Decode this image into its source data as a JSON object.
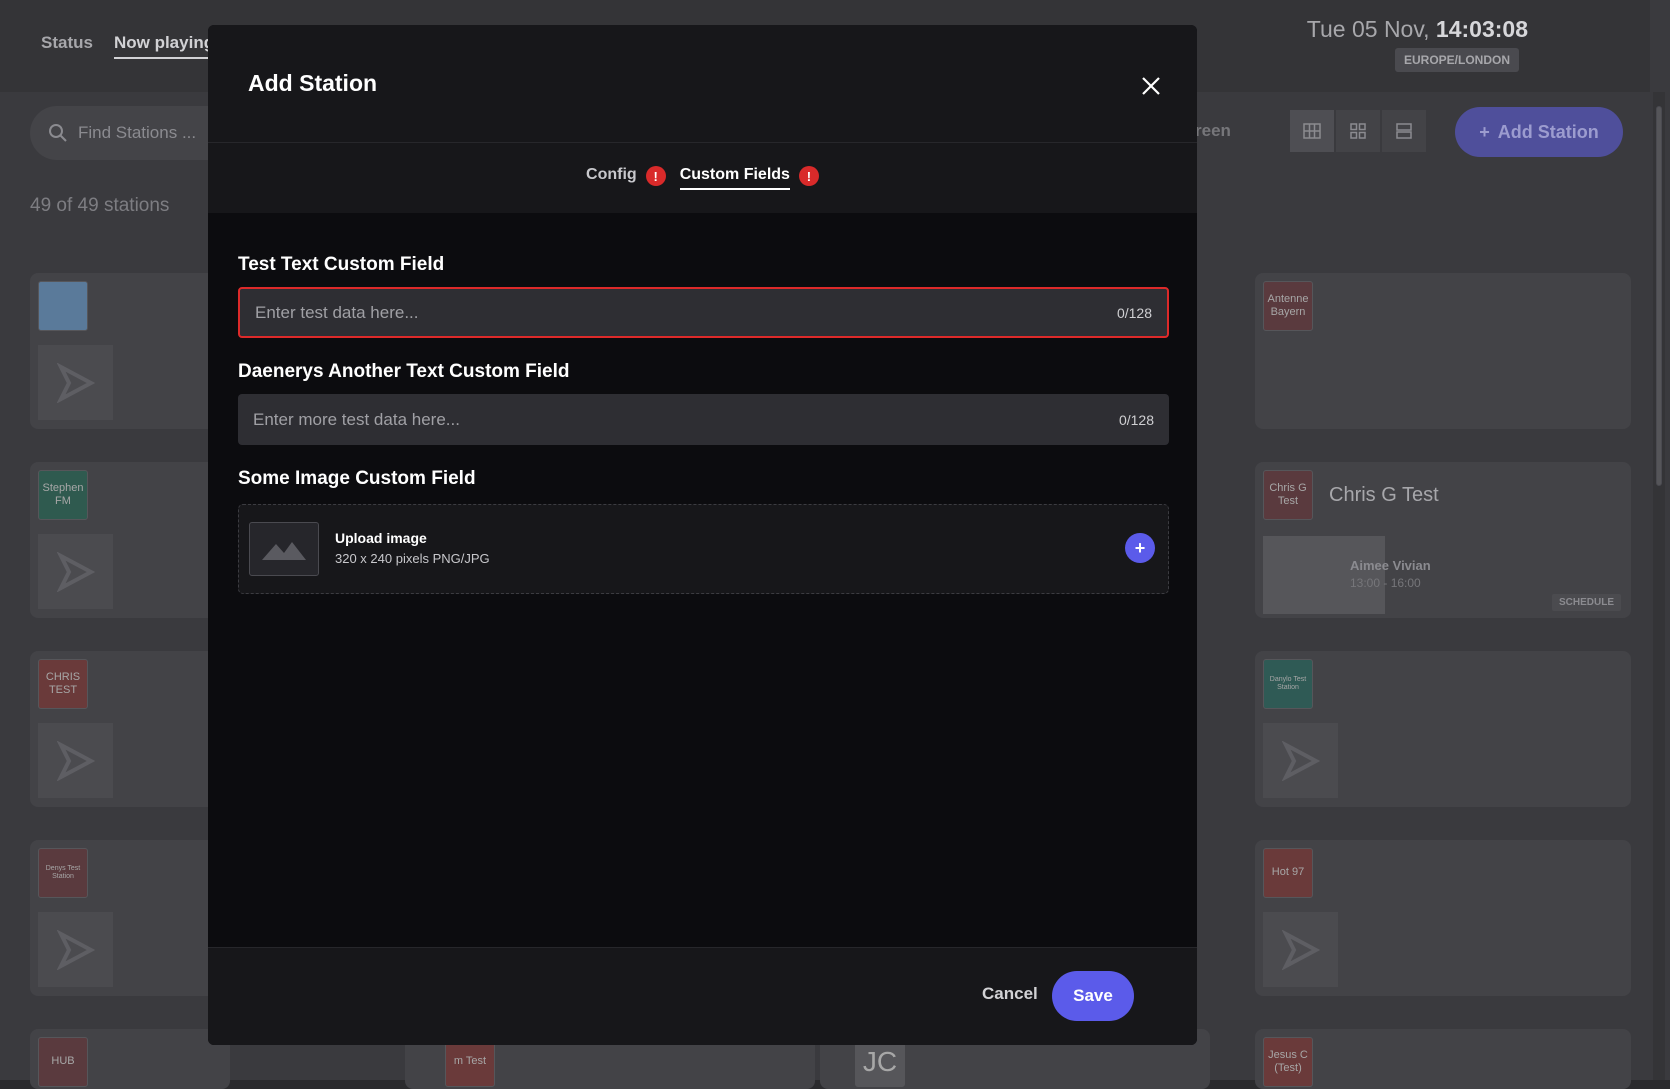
{
  "nav": {
    "status": "Status",
    "now_playing": "Now playing"
  },
  "clock": {
    "date": "Tue 05 Nov,",
    "time": "14:03:08",
    "timezone": "EUROPE/LONDON"
  },
  "search": {
    "placeholder": "Find Stations ..."
  },
  "station_count": "49 of 49 stations",
  "toolbar": {
    "screen_label": "reen",
    "add_station": "Add Station"
  },
  "stations_left": [
    {
      "logo": ""
    },
    {
      "logo": "Stephen FM"
    },
    {
      "logo": "CHRIS TEST"
    },
    {
      "logo": "Denys Test Station"
    },
    {
      "logo": "HUB"
    }
  ],
  "stations_right": [
    {
      "logo": "Antenne Bayern",
      "name": ""
    },
    {
      "logo": "Chris G Test",
      "name": "Chris G Test",
      "host": "Aimee Vivian",
      "time": "13:00 - 16:00",
      "schedule": "SCHEDULE"
    },
    {
      "logo": "Danylo Test Station",
      "name": ""
    },
    {
      "logo": "Hot 97",
      "name": ""
    },
    {
      "logo": "Jesus C (Test)",
      "name": ""
    }
  ],
  "partial_logos": [
    "m Test",
    "JC"
  ],
  "modal": {
    "title": "Add Station",
    "tabs": [
      {
        "label": "Config",
        "error": "!"
      },
      {
        "label": "Custom Fields",
        "error": "!"
      }
    ],
    "fields": [
      {
        "label": "Test Text Custom Field",
        "placeholder": "Enter test data here...",
        "counter": "0/128"
      },
      {
        "label": "Daenerys Another Text Custom Field",
        "placeholder": "Enter more test data here...",
        "counter": "0/128"
      }
    ],
    "image_field": {
      "label": "Some Image Custom Field",
      "title": "Upload image",
      "subtitle": "320 x 240 pixels PNG/JPG",
      "plus": "+"
    },
    "cancel": "Cancel",
    "save": "Save"
  }
}
